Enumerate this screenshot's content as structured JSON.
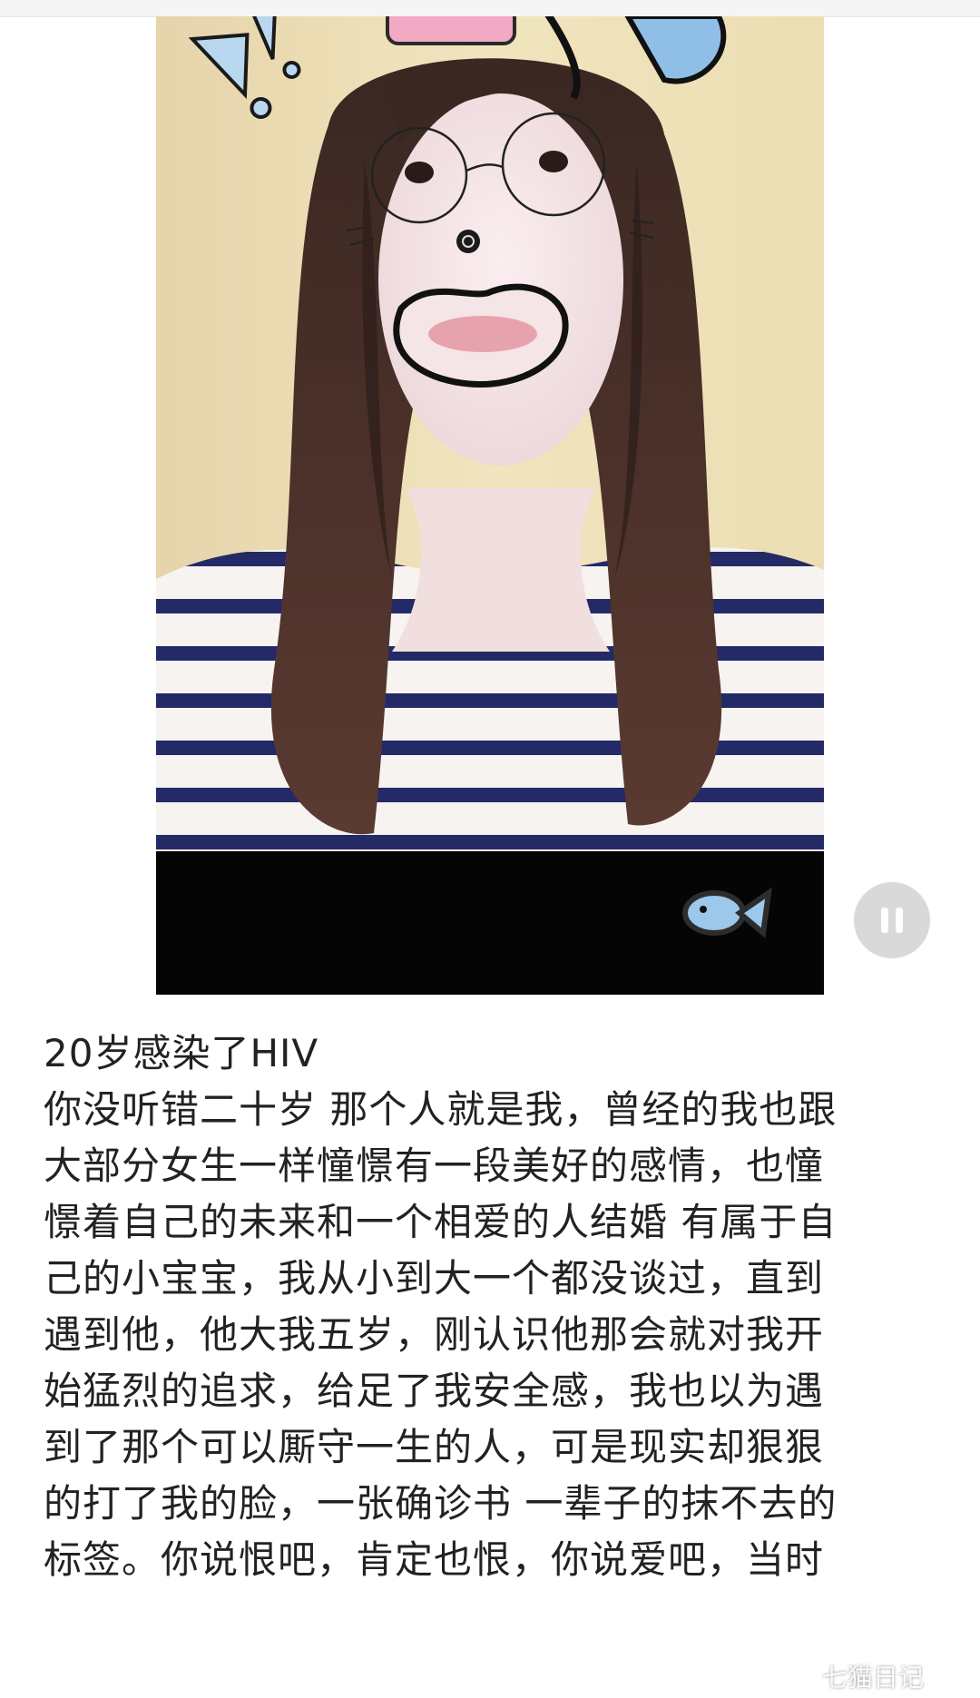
{
  "post": {
    "title": "20岁感染了HIV",
    "lines": [
      "你没听错二十岁 那个人就是我，曾经的我也跟",
      "大部分女生一样憧憬有一段美好的感情，也憧",
      "憬着自己的未来和一个相爱的人结婚 有属于自",
      "己的小宝宝，我从小到大一个都没谈过，直到",
      "遇到他，他大我五岁，刚认识他那会就对我开",
      "始猛烈的追求，给足了我安全感，我也以为遇",
      "到了那个可以厮守一生的人，可是现实却狠狠",
      "的打了我的脸，一张确诊书 一辈子的抹不去的",
      "标签。你说恨吧，肯定也恨，你说爱吧，当时"
    ]
  },
  "video": {
    "state": "playing",
    "snapshot_icon": "camera-icon",
    "pause_icon": "pause-icon"
  },
  "watermark": {
    "text": "七猫日记",
    "logo_icon": "weibo-logo-icon"
  },
  "colors": {
    "text": "#222222",
    "background": "#ffffff",
    "pause_button": "#d9d9d9"
  }
}
